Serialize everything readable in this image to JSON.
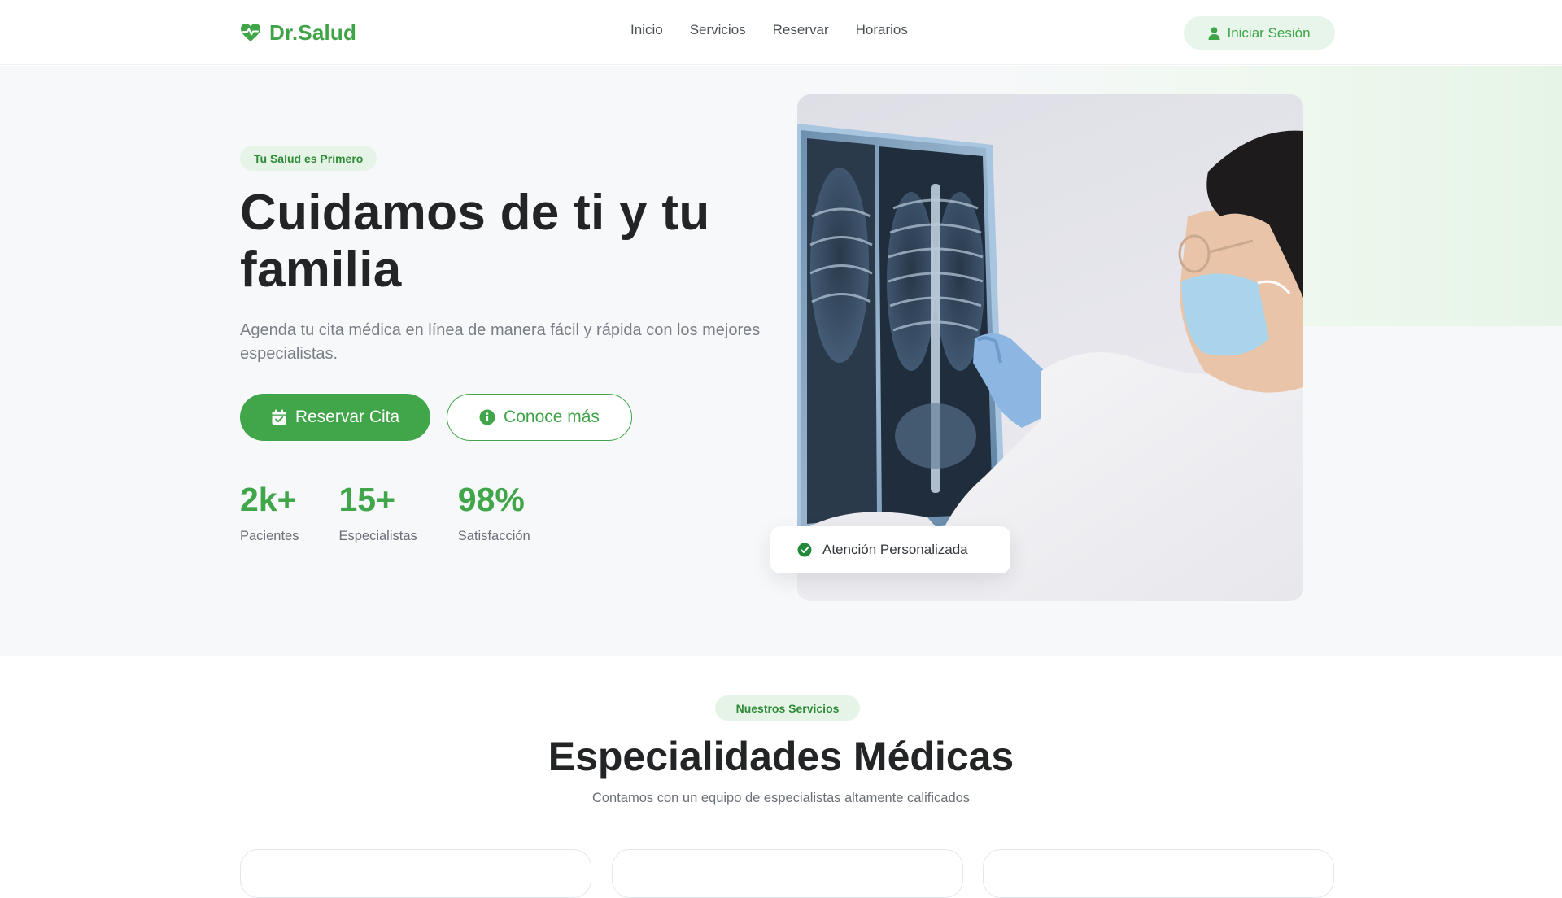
{
  "brand": {
    "name": "Dr.Salud",
    "icon": "heart-pulse-icon",
    "color": "#3fa348"
  },
  "nav": {
    "links": [
      {
        "label": "Inicio"
      },
      {
        "label": "Servicios"
      },
      {
        "label": "Reservar"
      },
      {
        "label": "Horarios"
      }
    ],
    "login": {
      "label": "Iniciar Sesión",
      "icon": "user-icon"
    }
  },
  "hero": {
    "tag": "Tu Salud es Primero",
    "title": "Cuidamos de ti y tu familia",
    "subtitle": "Agenda tu cita médica en línea de manera fácil y rápida con los mejores especialistas.",
    "primary_button": {
      "label": "Reservar Cita",
      "icon": "calendar-check-icon"
    },
    "secondary_button": {
      "label": "Conoce más",
      "icon": "info-circle-icon"
    },
    "stats": [
      {
        "value": "2k+",
        "label": "Pacientes"
      },
      {
        "value": "15+",
        "label": "Especialistas"
      },
      {
        "value": "98%",
        "label": "Satisfacción"
      }
    ],
    "image": {
      "subject": "doctor-examining-xray"
    },
    "badge": {
      "text": "Atención Personalizada",
      "icon": "check-circle-icon"
    }
  },
  "services": {
    "tag": "Nuestros Servicios",
    "title": "Especialidades Médicas",
    "subtitle": "Contamos con un equipo de especialistas altamente calificados",
    "cards": [
      {},
      {},
      {}
    ]
  },
  "colors": {
    "accent": "#41a549",
    "accent_light": "#e6f4e7",
    "hero_bg": "#f7f8fa",
    "text_dark": "#222426",
    "text_muted": "#7a7f86"
  }
}
